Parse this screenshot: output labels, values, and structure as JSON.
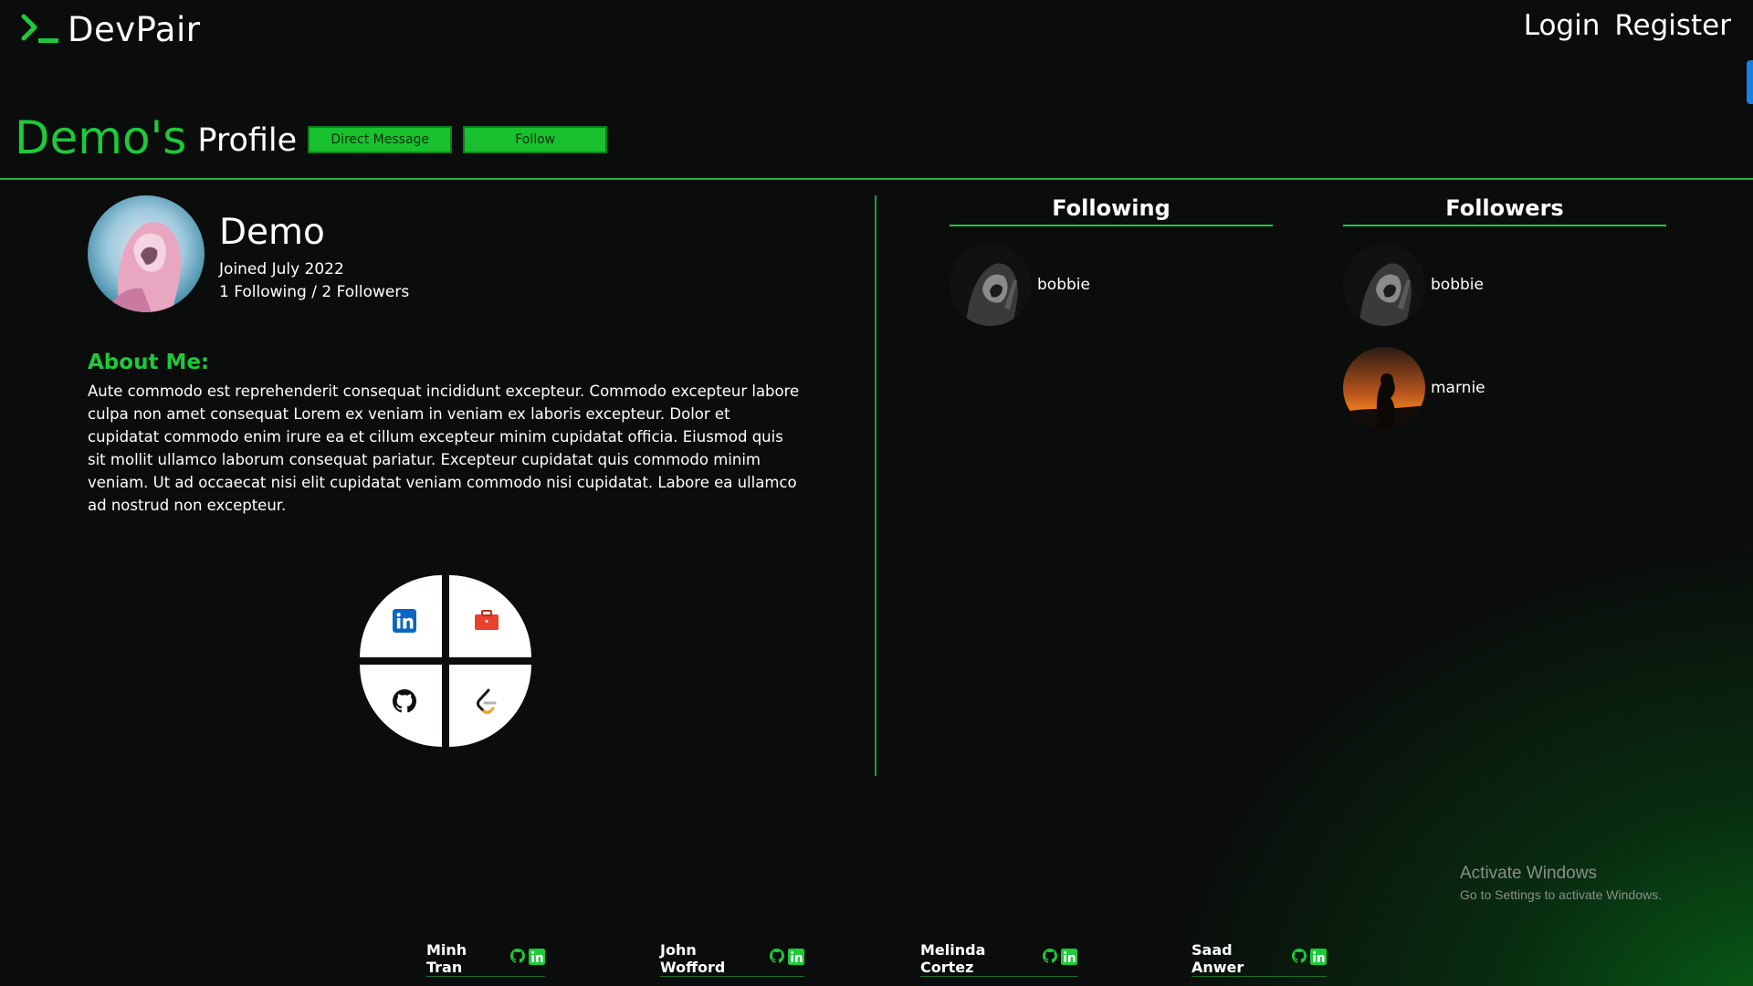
{
  "header": {
    "brand": "DevPair",
    "nav": {
      "login": "Login",
      "register": "Register"
    }
  },
  "profile_header": {
    "name_possessive": "Demo's",
    "suffix": "Profile",
    "direct_message_label": "Direct Message",
    "follow_label": "Follow"
  },
  "user": {
    "name": "Demo",
    "joined": "Joined July 2022",
    "counts": "1 Following / 2 Followers"
  },
  "about": {
    "heading": "About Me:",
    "text": "Aute commodo est reprehenderit consequat incididunt excepteur. Commodo excepteur labore culpa non amet consequat Lorem ex veniam in veniam ex laboris excepteur. Dolor et cupidatat commodo enim irure ea et cillum excepteur minim cupidatat officia. Eiusmod quis sit mollit ullamco laborum consequat pariatur. Excepteur cupidatat quis commodo minim veniam. Ut ad occaecat nisi elit cupidatat veniam commodo nisi cupidatat. Labore ea ullamco ad nostrud non excepteur."
  },
  "social_links": [
    {
      "icon": "linkedin-icon"
    },
    {
      "icon": "portfolio-briefcase-icon"
    },
    {
      "icon": "github-icon"
    },
    {
      "icon": "leetcode-icon"
    }
  ],
  "following": {
    "heading": "Following",
    "users": [
      {
        "name": "bobbie"
      }
    ]
  },
  "followers": {
    "heading": "Followers",
    "users": [
      {
        "name": "bobbie"
      },
      {
        "name": "marnie"
      }
    ]
  },
  "footer": {
    "contributors": [
      {
        "name": "Minh Tran"
      },
      {
        "name": "John Wofford"
      },
      {
        "name": "Melinda Cortez"
      },
      {
        "name": "Saad Anwer"
      }
    ]
  },
  "watermark": {
    "title": "Activate Windows",
    "subtitle": "Go to Settings to activate Windows."
  },
  "colors": {
    "accent_green": "#1ec93a",
    "button_green": "#18c12d",
    "background": "#0b0d0c"
  }
}
